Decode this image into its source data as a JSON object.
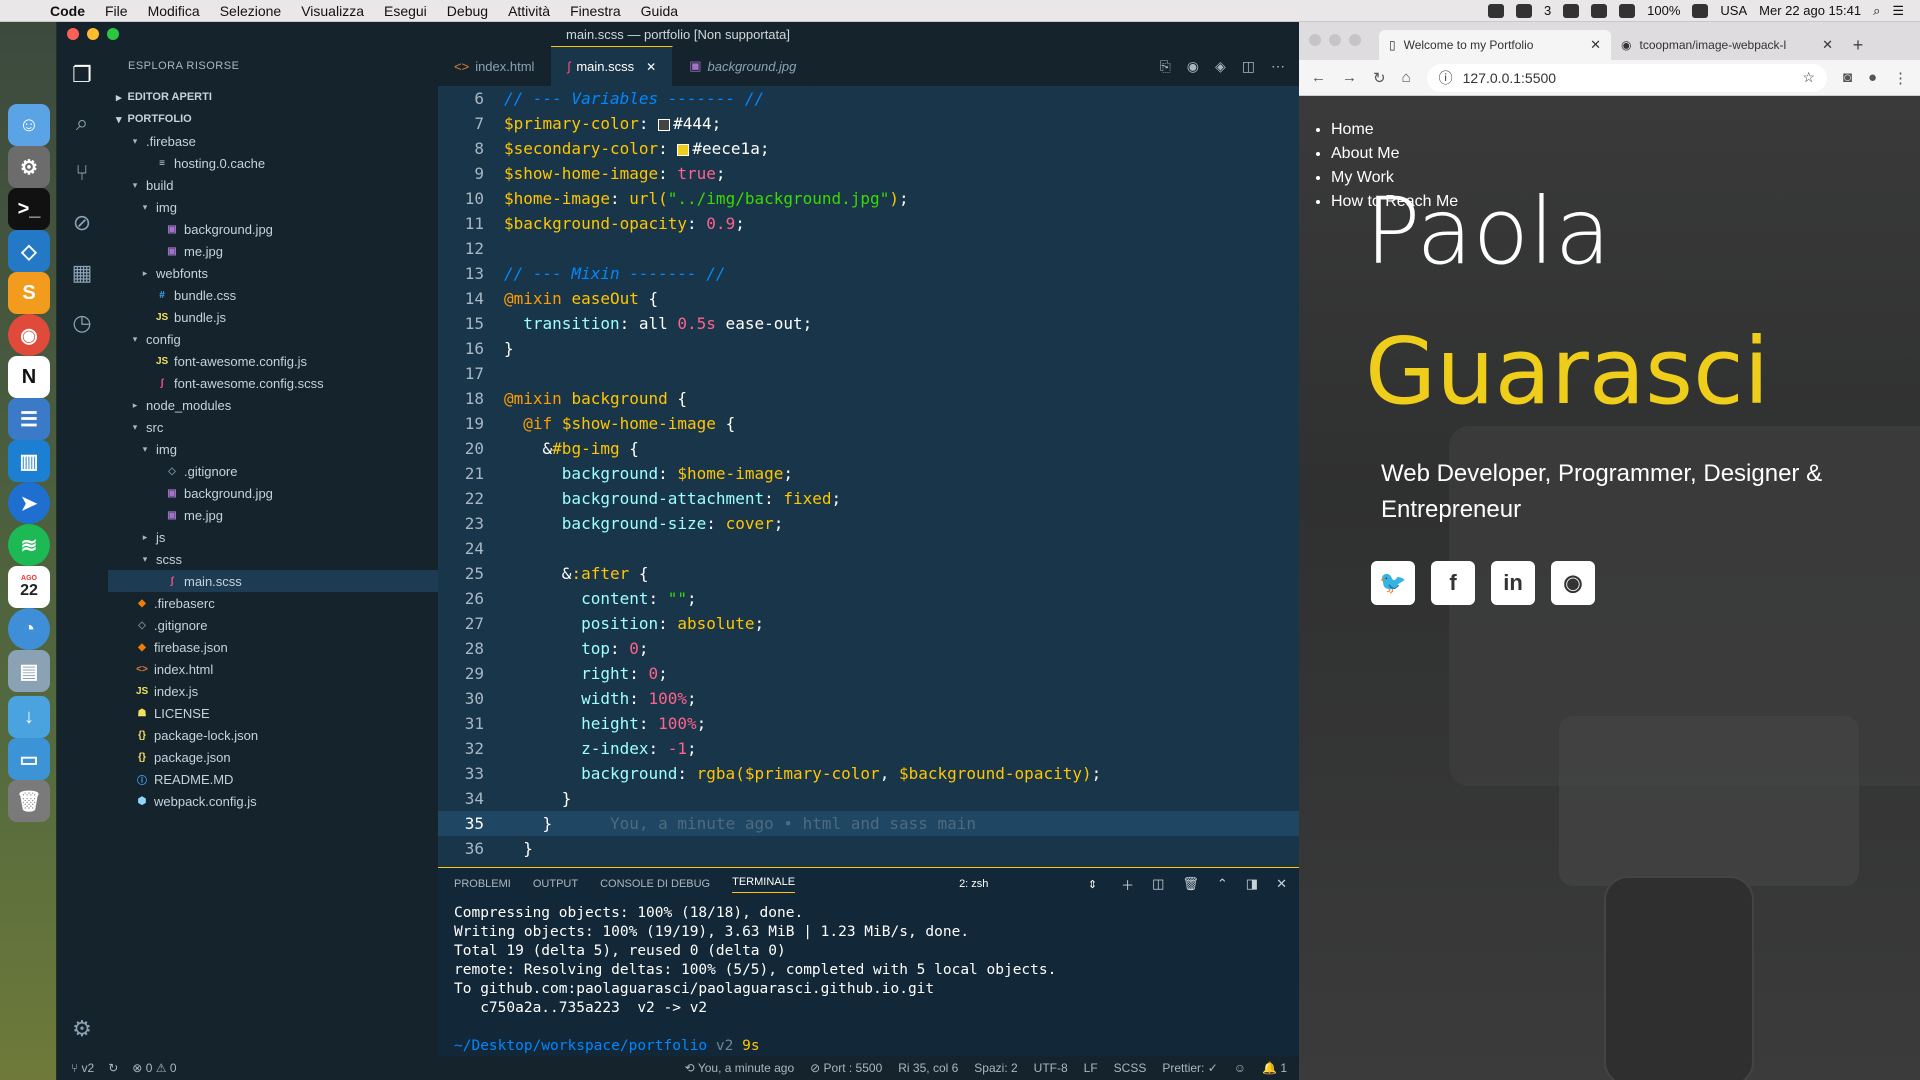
{
  "menubar": {
    "app": "Code",
    "items": [
      "File",
      "Modifica",
      "Selezione",
      "Visualizza",
      "Esegui",
      "Debug",
      "Attività",
      "Finestra",
      "Guida"
    ],
    "tray_badge": "3",
    "battery": "100%",
    "locale": "USA",
    "datetime": "Mer 22 ago  15:41"
  },
  "vscode": {
    "window_title": "main.scss — portfolio [Non supportata]",
    "sidebar": {
      "title": "ESPLORA RISORSE",
      "open_editors": "EDITOR APERTI",
      "project": "PORTFOLIO",
      "tree": [
        {
          "label": ".firebase",
          "twisty": "▾",
          "icon": "",
          "color": "#c7d2da"
        },
        {
          "label": "hosting.0.cache",
          "twisty": "",
          "icon": "≡",
          "color": "#c7d2da"
        },
        {
          "label": "build",
          "twisty": "▾",
          "icon": "",
          "color": "#c7d2da"
        },
        {
          "label": "img",
          "twisty": "▾",
          "icon": "",
          "color": "#c7d2da"
        },
        {
          "label": "background.jpg",
          "twisty": "",
          "icon": "▣",
          "color": "#a074c4"
        },
        {
          "label": "me.jpg",
          "twisty": "",
          "icon": "▣",
          "color": "#a074c4"
        },
        {
          "label": "webfonts",
          "twisty": "▸",
          "icon": "",
          "color": "#c7d2da"
        },
        {
          "label": "bundle.css",
          "twisty": "",
          "icon": "#",
          "color": "#42a5f5"
        },
        {
          "label": "bundle.js",
          "twisty": "",
          "icon": "JS",
          "color": "#f1e05a"
        },
        {
          "label": "config",
          "twisty": "▾",
          "icon": "",
          "color": "#c7d2da"
        },
        {
          "label": "font-awesome.config.js",
          "twisty": "",
          "icon": "JS",
          "color": "#f1e05a"
        },
        {
          "label": "font-awesome.config.scss",
          "twisty": "",
          "icon": "ʃ",
          "color": "#f55385"
        },
        {
          "label": "node_modules",
          "twisty": "▸",
          "icon": "",
          "color": "#c7d2da"
        },
        {
          "label": "src",
          "twisty": "▾",
          "icon": "",
          "color": "#c7d2da"
        },
        {
          "label": "img",
          "twisty": "▾",
          "icon": "",
          "color": "#c7d2da"
        },
        {
          "label": ".gitignore",
          "twisty": "",
          "icon": "◇",
          "color": "#6b8799"
        },
        {
          "label": "background.jpg",
          "twisty": "",
          "icon": "▣",
          "color": "#a074c4"
        },
        {
          "label": "me.jpg",
          "twisty": "",
          "icon": "▣",
          "color": "#a074c4"
        },
        {
          "label": "js",
          "twisty": "▸",
          "icon": "",
          "color": "#c7d2da"
        },
        {
          "label": "scss",
          "twisty": "▾",
          "icon": "",
          "color": "#c7d2da"
        },
        {
          "label": "main.scss",
          "twisty": "",
          "icon": "ʃ",
          "color": "#f55385"
        },
        {
          "label": ".firebaserc",
          "twisty": "",
          "icon": "◆",
          "color": "#f57c00"
        },
        {
          "label": ".gitignore",
          "twisty": "",
          "icon": "◇",
          "color": "#6b8799"
        },
        {
          "label": "firebase.json",
          "twisty": "",
          "icon": "◆",
          "color": "#f57c00"
        },
        {
          "label": "index.html",
          "twisty": "",
          "icon": "<>",
          "color": "#e37933"
        },
        {
          "label": "index.js",
          "twisty": "",
          "icon": "JS",
          "color": "#f1e05a"
        },
        {
          "label": "LICENSE",
          "twisty": "",
          "icon": "☗",
          "color": "#f1e05a"
        },
        {
          "label": "package-lock.json",
          "twisty": "",
          "icon": "{}",
          "color": "#f1e05a"
        },
        {
          "label": "package.json",
          "twisty": "",
          "icon": "{}",
          "color": "#f1e05a"
        },
        {
          "label": "README.MD",
          "twisty": "",
          "icon": "ⓘ",
          "color": "#42a5f5"
        },
        {
          "label": "webpack.config.js",
          "twisty": "",
          "icon": "⬢",
          "color": "#8ed6fb"
        }
      ]
    },
    "tabs": [
      {
        "label": "index.html",
        "icon": "<>",
        "active": false
      },
      {
        "label": "main.scss",
        "icon": "ʃ",
        "active": true
      },
      {
        "label": "background.jpg",
        "icon": "▣",
        "active": false
      }
    ],
    "code": {
      "current_line": 35,
      "lines": [
        {
          "n": 6,
          "html": "<span class='c-cmt'>// --- Variables ------- //</span>"
        },
        {
          "n": 7,
          "html": "<span class='c-var'>$primary-color</span>: <span class='swatch' style='background:#444'></span><span class='c-val'>#444</span>;"
        },
        {
          "n": 8,
          "html": "<span class='c-var'>$secondary-color</span>: <span class='swatch' style='background:#eece1a'></span><span class='c-val'>#eece1a</span>;"
        },
        {
          "n": 9,
          "html": "<span class='c-var'>$show-home-image</span>: <span class='c-num'>true</span>;"
        },
        {
          "n": 10,
          "html": "<span class='c-var'>$home-image</span>: <span class='c-fn'>url(</span><span class='c-str'>\"../img/background.jpg\"</span><span class='c-fn'>)</span>;"
        },
        {
          "n": 11,
          "html": "<span class='c-var'>$background-opacity</span>: <span class='c-num'>0.9</span>;"
        },
        {
          "n": 12,
          "html": ""
        },
        {
          "n": 13,
          "html": "<span class='c-cmt'>// --- Mixin ------- //</span>"
        },
        {
          "n": 14,
          "html": "<span class='c-kw'>@mixin</span> <span class='c-fn'>easeOut</span> {"
        },
        {
          "n": 15,
          "html": "  <span class='c-prop'>transition</span>: all <span class='c-num'>0.5s</span> ease-out;"
        },
        {
          "n": 16,
          "html": "}"
        },
        {
          "n": 17,
          "html": ""
        },
        {
          "n": 18,
          "html": "<span class='c-kw'>@mixin</span> <span class='c-fn'>background</span> {"
        },
        {
          "n": 19,
          "html": "  <span class='c-kw'>@if</span> <span class='c-var'>$show-home-image</span> {"
        },
        {
          "n": 20,
          "html": "    &amp;<span class='c-fn'>#bg-img</span> {"
        },
        {
          "n": 21,
          "html": "      <span class='c-prop'>background</span>: <span class='c-var'>$home-image</span>;"
        },
        {
          "n": 22,
          "html": "      <span class='c-prop'>background-attachment</span>: <span class='c-fn'>fixed</span>;"
        },
        {
          "n": 23,
          "html": "      <span class='c-prop'>background-size</span>: <span class='c-fn'>cover</span>;"
        },
        {
          "n": 24,
          "html": ""
        },
        {
          "n": 25,
          "html": "      &amp;<span class='c-fn'>:after</span> {"
        },
        {
          "n": 26,
          "html": "        <span class='c-prop'>content</span>: <span class='c-str'>\"\"</span>;"
        },
        {
          "n": 27,
          "html": "        <span class='c-prop'>position</span>: <span class='c-fn'>absolute</span>;"
        },
        {
          "n": 28,
          "html": "        <span class='c-prop'>top</span>: <span class='c-num'>0</span>;"
        },
        {
          "n": 29,
          "html": "        <span class='c-prop'>right</span>: <span class='c-num'>0</span>;"
        },
        {
          "n": 30,
          "html": "        <span class='c-prop'>width</span>: <span class='c-num'>100%</span>;"
        },
        {
          "n": 31,
          "html": "        <span class='c-prop'>height</span>: <span class='c-num'>100%</span>;"
        },
        {
          "n": 32,
          "html": "        <span class='c-prop'>z-index</span>: <span class='c-num'>-1</span>;"
        },
        {
          "n": 33,
          "html": "        <span class='c-prop'>background</span>: <span class='c-fn'>rgba(</span><span class='c-var'>$primary-color</span>, <span class='c-var'>$background-opacity</span><span class='c-fn'>)</span>;"
        },
        {
          "n": 34,
          "html": "      }"
        },
        {
          "n": 35,
          "html": "    }<span class='c-blame'>      You, a minute ago • html and sass main</span>"
        },
        {
          "n": 36,
          "html": "  }"
        }
      ]
    },
    "panel": {
      "tabs": [
        "PROBLEMI",
        "OUTPUT",
        "CONSOLE DI DEBUG",
        "TERMINALE"
      ],
      "active_tab": "TERMINALE",
      "terminal_select": "2: zsh",
      "terminal_lines": [
        "Compressing objects: 100% (18/18), done.",
        "Writing objects: 100% (19/19), 3.63 MiB | 1.23 MiB/s, done.",
        "Total 19 (delta 5), reused 0 (delta 0)",
        "remote: Resolving deltas: 100% (5/5), completed with 5 local objects.",
        "To github.com:paolaguarasci/paolaguarasci.github.io.git",
        "   c750a2a..735a223  v2 -> v2",
        ""
      ],
      "prompt_path": "~/Desktop/workspace/portfolio",
      "prompt_branch": "v2",
      "prompt_time": "9s",
      "prompt_symbol": "❯"
    },
    "statusbar": {
      "branch": "v2",
      "errors": "0",
      "warnings": "0",
      "blame": "You, a minute ago",
      "port": "Port : 5500",
      "cursor": "Ri 35, col 6",
      "spaces": "Spazi: 2",
      "encoding": "UTF-8",
      "eol": "LF",
      "language": "SCSS",
      "prettier": "Prettier: ✓",
      "notifications": "1"
    }
  },
  "chrome": {
    "tabs": [
      {
        "label": "Welcome to my Portfolio",
        "active": true
      },
      {
        "label": "tcoopman/image-webpack-l",
        "active": false
      }
    ],
    "url": "127.0.0.1:5500",
    "page": {
      "nav": [
        "Home",
        "About Me",
        "My Work",
        "How to Reach Me"
      ],
      "first_name": "Paola",
      "last_name": "Guarasci",
      "tagline": "Web Developer, Programmer, Designer & Entrepreneur",
      "socials": [
        "twitter-icon",
        "facebook-icon",
        "linkedin-icon",
        "github-icon"
      ],
      "accent_color": "#eece1a"
    }
  },
  "dock": {
    "calendar_day": "22",
    "calendar_month": "AGO"
  }
}
